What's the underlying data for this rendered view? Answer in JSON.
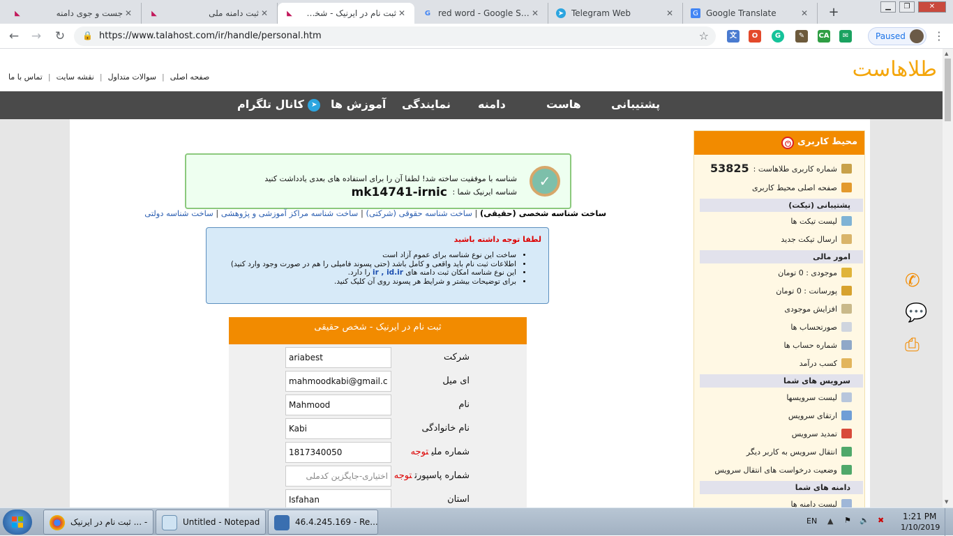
{
  "browser": {
    "tabs": [
      {
        "title": "جست و جوی دامنه",
        "icon": "green-pink-favicon-icon"
      },
      {
        "title": "ثبت دامنه ملی",
        "icon": "green-pink-favicon-icon"
      },
      {
        "title": "ثبت نام در ایرنیک - شخص حقیقی",
        "icon": "green-pink-favicon-icon"
      },
      {
        "title": "red word - Google Search",
        "icon": "google-icon"
      },
      {
        "title": "Telegram Web",
        "icon": "telegram-icon"
      },
      {
        "title": "Google Translate",
        "icon": "translate-icon"
      }
    ],
    "new_tab": "+",
    "url": "https://www.talahost.com/ir/handle/personal.htm",
    "profile_status": "Paused"
  },
  "site": {
    "logo": "طلاهاست",
    "top_links": [
      "صفحه اصلی",
      "سوالات متداول",
      "نقشه سایت",
      "تماس با ما"
    ],
    "nav": [
      "پشتیبانی",
      "هاست",
      "دامنه",
      "نمایندگی",
      "آموزش ها",
      "کانال تلگرام"
    ]
  },
  "success": {
    "message": "شناسه با موفقیت ساخته شد! لطفا آن را برای استفاده های بعدی یادداشت کنید",
    "label": "شناسه ایرنیک شما :",
    "code": "mk14741-irnic"
  },
  "id_types": {
    "current": "ساخت شناسه شخصی (حقیقی)",
    "links": [
      "ساخت شناسه حقوقی (شرکتی)",
      "ساخت شناسه مراکز آموزشی و پژوهشی",
      "ساخت شناسه دولتی"
    ]
  },
  "notice": {
    "title": "لطفا توجه داشته باشید",
    "items": [
      "ساخت این نوع شناسه برای عموم آزاد است",
      "اطلاعات ثبت نام باید واقعی و کامل باشد (حتی پسوند فامیلی را هم در صورت وجود وارد کنید)",
      "این نوع شناسه امکان ثبت دامنه های",
      "برای توضیحات بیشتر و شرایط هر پسوند روی آن کلیک کنید."
    ],
    "item3_bold": "ir , id.ir",
    "item3_tail": "را دارد."
  },
  "form": {
    "title": "ثبت نام در ایرنیک - شخص حقیقی",
    "attention": "توجه",
    "fields": [
      {
        "label": "شرکت",
        "value": "ariabest"
      },
      {
        "label": "ای میل",
        "value": "mahmoodkabi@gmail.co"
      },
      {
        "label": "نام",
        "value": "Mahmood"
      },
      {
        "label": "نام خانوادگی",
        "value": "Kabi"
      },
      {
        "label": "شماره ملی",
        "value": "1817340050"
      },
      {
        "label": "شماره پاسپورت",
        "value": "",
        "placeholder": "اختیاری-جایگزین کدملی"
      },
      {
        "label": "استان",
        "value": "Isfahan"
      }
    ]
  },
  "sidebar": {
    "title": "محیط کاربری",
    "user_id_label": "شماره کاربری طلاهاست :",
    "user_id": "53825",
    "home": "صفحه اصلی محیط کاربری",
    "support_title": "پشتیبانی (تیکت)",
    "support": [
      "لیست تیکت ها",
      "ارسال تیکت جدید"
    ],
    "finance_title": "امور مالی",
    "finance": [
      "موجودی : 0 تومان",
      "پورسانت : 0 تومان",
      "افزایش موجودی",
      "صورتحساب ها",
      "شماره حساب ها",
      "کسب درآمد"
    ],
    "services_title": "سرویس های شما",
    "services": [
      "لیست سرویسها",
      "ارتقای سرویس",
      "تمدید سرویس",
      "انتقال سرویس به کاربر دیگر",
      "وضعیت درخواست های انتقال سرویس"
    ],
    "domains_title": "دامنه های شما",
    "domains": [
      "لیست دامنه ها"
    ]
  },
  "taskbar": {
    "items": [
      "ثبت نام در ایرنیک ... -",
      "Untitled - Notepad",
      "46.4.245.169 - Re..."
    ],
    "lang": "EN",
    "time": "1:21 PM",
    "date": "1/10/2019"
  }
}
